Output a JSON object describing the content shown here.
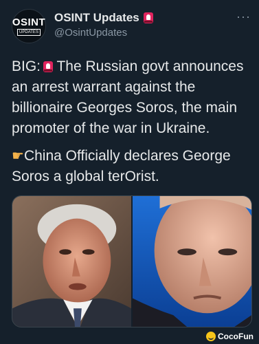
{
  "account": {
    "avatar_line1": "OSINT",
    "avatar_line2": "UPDATES",
    "display_name": "OSINT Updates",
    "handle": "@OsintUpdates",
    "badge_icon": "siren-icon"
  },
  "menu": {
    "more_label": "···"
  },
  "tweet": {
    "line1_prefix": "BIG:",
    "line1_rest": " The Russian govt announces an arrest warrant against the billionaire Georges Soros, the main promoter of the war in Ukraine.",
    "line2": "China Officially declares George Soros a global terOrist.",
    "pointer_icon": "pointing-hand-icon"
  },
  "media": {
    "left_photo": "older-man-photo",
    "right_photo": "man-in-suit-photo"
  },
  "watermark": {
    "label": "CocoFun"
  },
  "colors": {
    "background": "#15202b",
    "text": "#e7e9ea",
    "muted": "#8b98a5",
    "siren": "#e0245e"
  }
}
